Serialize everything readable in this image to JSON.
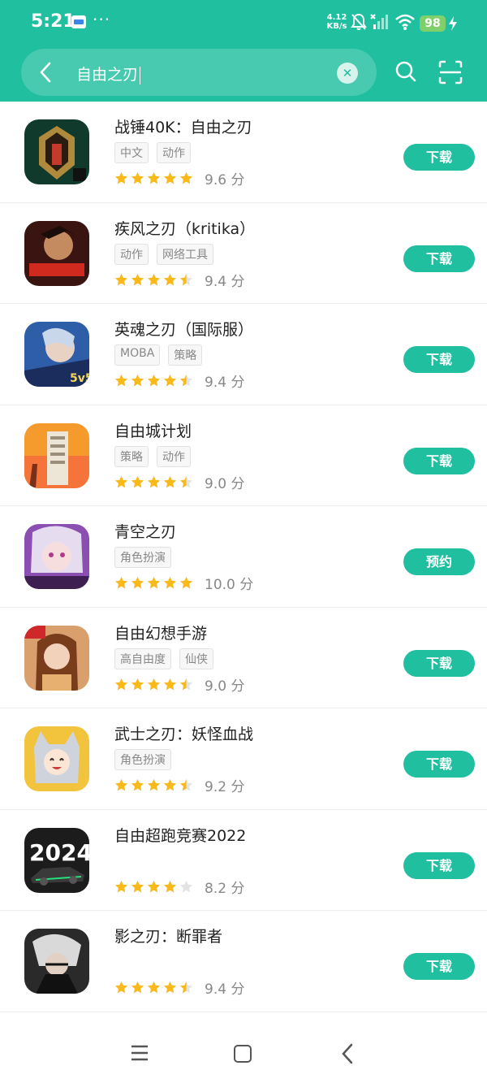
{
  "status_bar": {
    "time": "5:21",
    "speed_value": "4.12",
    "speed_unit": "KB/s",
    "battery": "98"
  },
  "search": {
    "query": "自由之刃"
  },
  "apps": [
    {
      "name": "战锤40K：自由之刃",
      "tags": [
        "中文",
        "动作"
      ],
      "rating": 5,
      "score": "9.6 分",
      "button": "下载"
    },
    {
      "name": "疾风之刃（kritika）",
      "tags": [
        "动作",
        "网络工具"
      ],
      "rating": 4.5,
      "score": "9.4 分",
      "button": "下载"
    },
    {
      "name": "英魂之刃（国际服）",
      "tags": [
        "MOBA",
        "策略"
      ],
      "rating": 4.5,
      "score": "9.4 分",
      "button": "下载"
    },
    {
      "name": "自由城计划",
      "tags": [
        "策略",
        "动作"
      ],
      "rating": 4.5,
      "score": "9.0 分",
      "button": "下载"
    },
    {
      "name": "青空之刃",
      "tags": [
        "角色扮演"
      ],
      "rating": 5,
      "score": "10.0 分",
      "button": "预约"
    },
    {
      "name": "自由幻想手游",
      "tags": [
        "高自由度",
        "仙侠"
      ],
      "rating": 4.5,
      "score": "9.0 分",
      "button": "下载"
    },
    {
      "name": "武士之刃：妖怪血战",
      "tags": [
        "角色扮演"
      ],
      "rating": 4.5,
      "score": "9.2 分",
      "button": "下载"
    },
    {
      "name": "自由超跑竞赛2022",
      "tags": [],
      "rating": 4,
      "score": "8.2 分",
      "button": "下载",
      "icon_text": "2024"
    },
    {
      "name": "影之刃：断罪者",
      "tags": [],
      "rating": 4.5,
      "score": "9.4 分",
      "button": "下载"
    }
  ],
  "colors": {
    "accent": "#1fbf9f",
    "star": "#f8b91c",
    "star_empty": "#e3e3e3"
  }
}
